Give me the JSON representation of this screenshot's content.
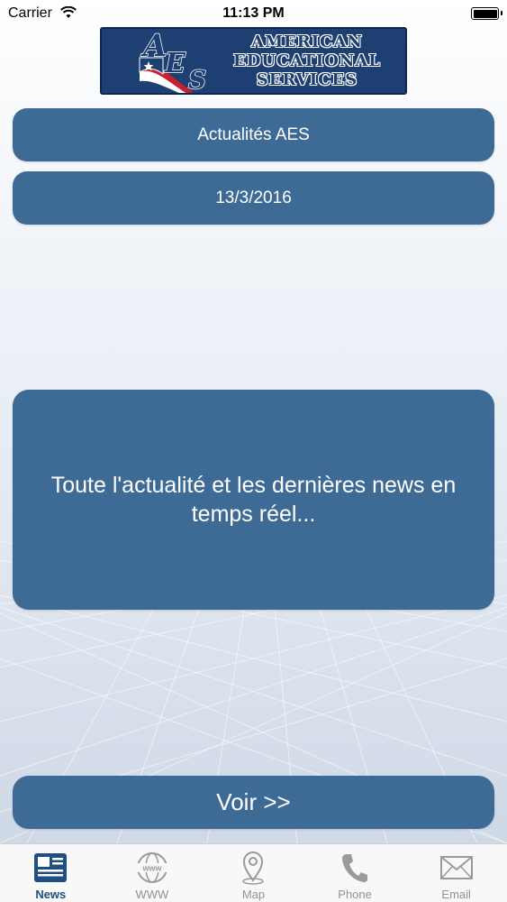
{
  "status_bar": {
    "carrier": "Carrier",
    "time": "11:13 PM",
    "battery_level": 1.0
  },
  "logo": {
    "monogram": "AES",
    "lines": [
      "AMERICAN",
      "EDUCATIONAL",
      "SERVICES"
    ]
  },
  "main": {
    "title": "Actualités AES",
    "date": "13/3/2016",
    "description": "Toute l'actualité et les dernières news en temps réel...",
    "voir_button": "Voir >>"
  },
  "tab_bar": {
    "active_index": 0,
    "tabs": [
      {
        "label": "News",
        "icon": "newspaper-icon"
      },
      {
        "label": "WWW",
        "icon": "globe-icon"
      },
      {
        "label": "Map",
        "icon": "map-pin-icon"
      },
      {
        "label": "Phone",
        "icon": "phone-icon"
      },
      {
        "label": "Email",
        "icon": "envelope-icon"
      }
    ]
  },
  "colors": {
    "pill_background": "#3e6b96",
    "logo_navy": "#1e3f72",
    "active_tab": "#1f4f82",
    "inactive_tab": "#929292"
  }
}
